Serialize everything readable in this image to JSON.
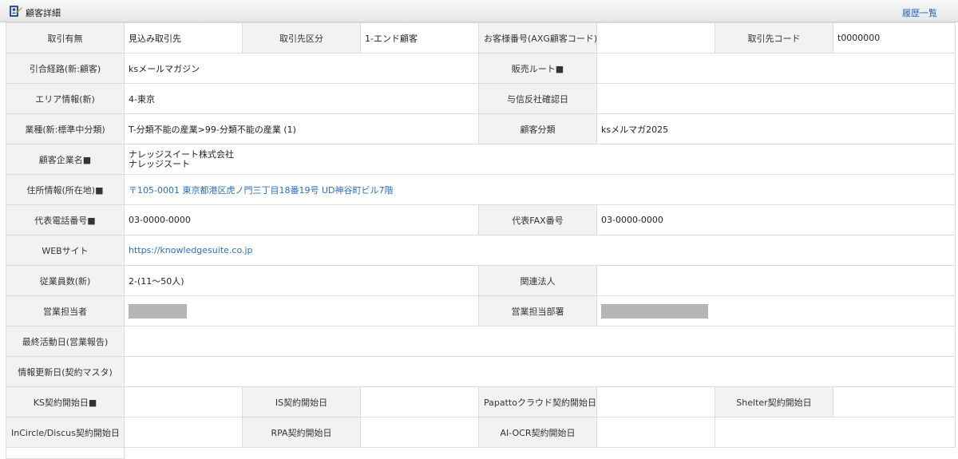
{
  "header": {
    "title": "顧客詳細",
    "history_link": "履歴一覧"
  },
  "fields": {
    "deal_status": {
      "label": "取引有無",
      "value": "見込み取引先"
    },
    "partner_class": {
      "label": "取引先区分",
      "value": "1-エンド顧客"
    },
    "customer_no": {
      "label": "お客様番号(AXG顧客コード)",
      "value": ""
    },
    "partner_code": {
      "label": "取引先コード",
      "value": "t0000000"
    },
    "referral": {
      "label": "引合経路(新:顧客)",
      "value": "ksメールマガジン"
    },
    "sales_route": {
      "label": "販売ルート■",
      "value": ""
    },
    "area": {
      "label": "エリア情報(新)",
      "value": "4-東京"
    },
    "credit_check": {
      "label": "与信反社確認日",
      "value": ""
    },
    "industry": {
      "label": "業種(新:標準中分類)",
      "value": "T-分類不能の産業>99-分類不能の産業 (1)"
    },
    "customer_category": {
      "label": "顧客分類",
      "value": "ksメルマガ2025"
    },
    "company_name": {
      "label": "顧客企業名■",
      "value_line1": "ナレッジスイート株式会社",
      "value_line2": "ナレッジスート"
    },
    "address": {
      "label": "住所情報(所在地)■",
      "value": "〒105-0001 東京都港区虎ノ門三丁目18番19号 UD神谷町ビル7階"
    },
    "phone": {
      "label": "代表電話番号■",
      "value": "03-0000-0000"
    },
    "fax": {
      "label": "代表FAX番号",
      "value": "03-0000-0000"
    },
    "website": {
      "label": "WEBサイト",
      "value": "https://knowledgesuite.co.jp"
    },
    "employees": {
      "label": "従業員数(新)",
      "value": "2-(11〜50人)"
    },
    "affiliates": {
      "label": "関連法人",
      "value": ""
    },
    "sales_rep": {
      "label": "営業担当者"
    },
    "sales_dept": {
      "label": "営業担当部署"
    },
    "last_activity": {
      "label": "最終活動日(営業報告)",
      "value": ""
    },
    "info_updated": {
      "label": "情報更新日(契約マスタ)",
      "value": ""
    },
    "ks_contract": {
      "label": "KS契約開始日■",
      "value": ""
    },
    "is_contract": {
      "label": "IS契約開始日",
      "value": ""
    },
    "papatto_contract": {
      "label": "Papattoクラウド契約開始日",
      "value": ""
    },
    "shelter_contract": {
      "label": "Shelter契約開始日",
      "value": ""
    },
    "incircle_contract": {
      "label": "InCircle/Discus契約開始日",
      "value": ""
    },
    "rpa_contract": {
      "label": "RPA契約開始日",
      "value": ""
    },
    "aiocr_contract": {
      "label": "AI-OCR契約開始日",
      "value": ""
    }
  },
  "colors": {
    "label_bg": "#f2f2f2",
    "border": "#dcdcdc",
    "link": "#2b6fbf",
    "mask": "#b4b4b4"
  }
}
